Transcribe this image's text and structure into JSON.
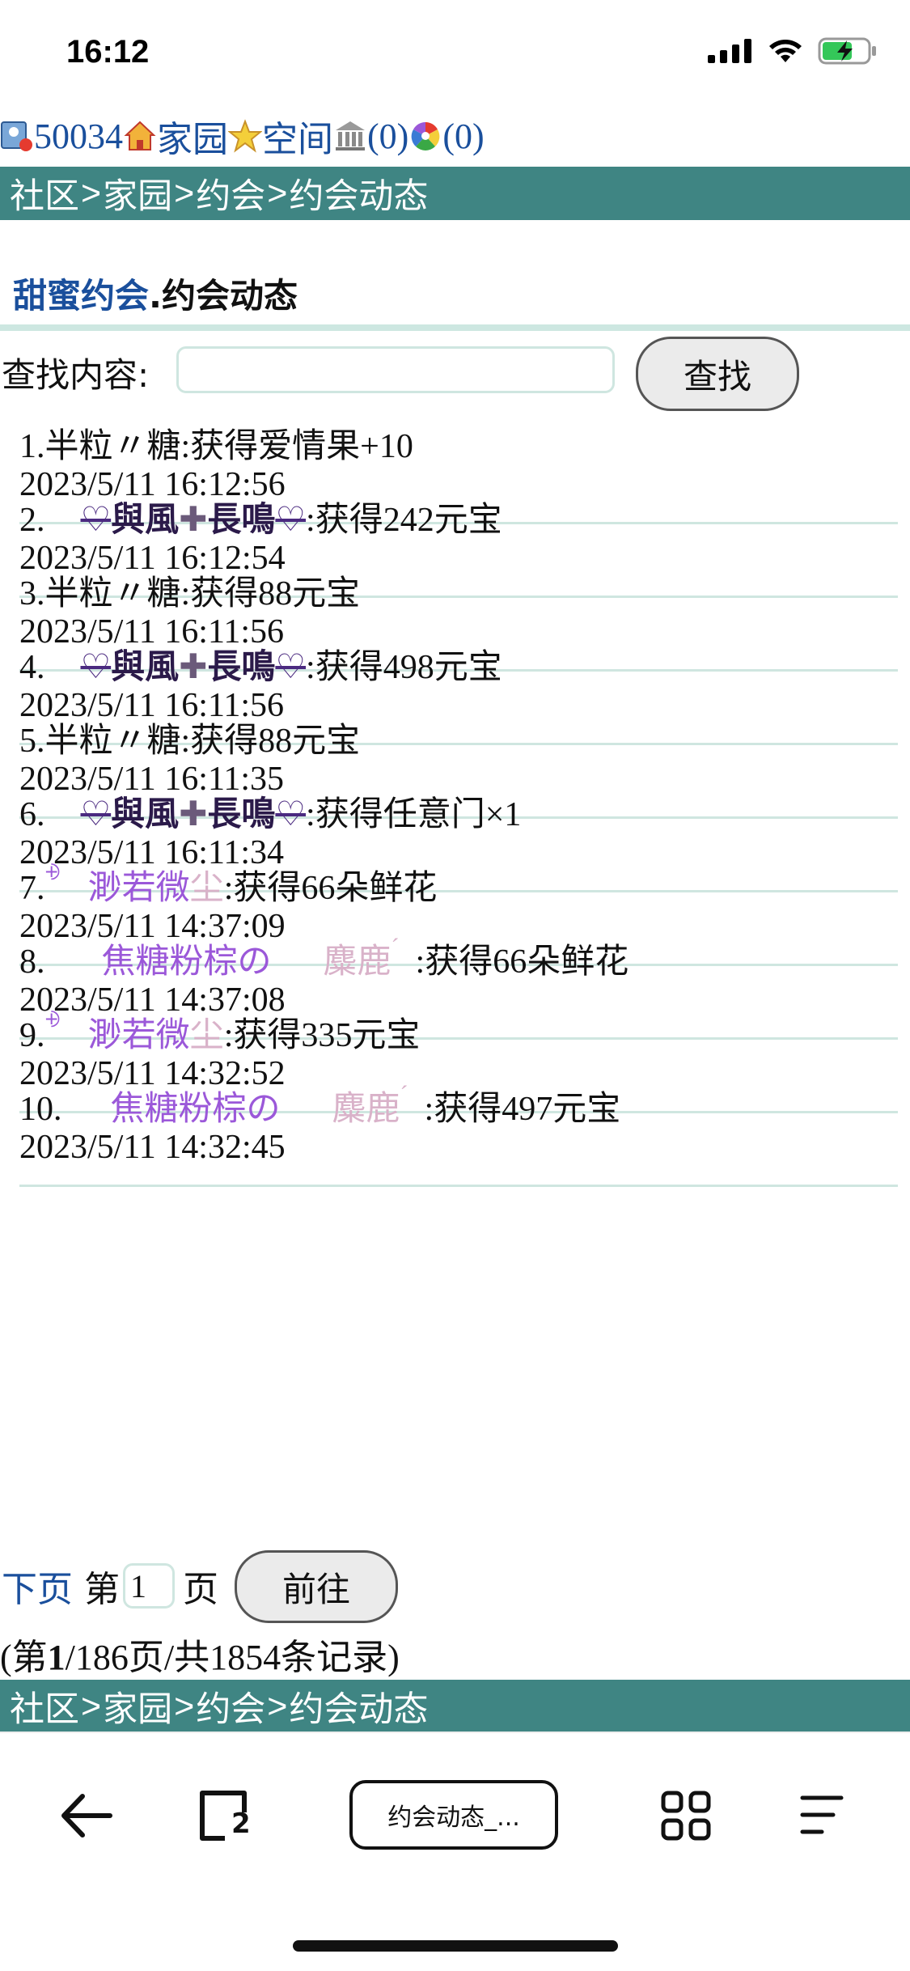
{
  "status": {
    "time": "16:12"
  },
  "topnav": {
    "user_id": "50034",
    "home": "家园",
    "space": "空间",
    "count1": "(0)",
    "count2": "(0)"
  },
  "breadcrumb": {
    "a": "社区",
    "b": "家园",
    "c": "约会",
    "d": "约会动态",
    "sep": ">"
  },
  "title": {
    "site": "甜蜜约会",
    "page": ".约会动态"
  },
  "search": {
    "label": "查找内容:",
    "button": "查找",
    "value": ""
  },
  "records": [
    {
      "no": "1.",
      "user": "半粒〃糖",
      "action": ":获得爱情果+10",
      "time": "2023/5/11 16:12:56",
      "style": "plain"
    },
    {
      "no": "2.",
      "user_parts": [
        "與風",
        "長鳴"
      ],
      "action": ":获得242元宝",
      "time": "2023/5/11 16:12:54",
      "style": "heart"
    },
    {
      "no": "3.",
      "user": "半粒〃糖",
      "action": ":获得88元宝",
      "time": "2023/5/11 16:11:56",
      "style": "plain"
    },
    {
      "no": "4.",
      "user_parts": [
        "與風",
        "長鳴"
      ],
      "action": ":获得498元宝",
      "time": "2023/5/11 16:11:56",
      "style": "heart"
    },
    {
      "no": "5.",
      "user": "半粒〃糖",
      "action": ":获得88元宝",
      "time": "2023/5/11 16:11:35",
      "style": "plain"
    },
    {
      "no": "6.",
      "user_parts": [
        "與風",
        "長鳴"
      ],
      "action": ":获得任意门×1",
      "time": "2023/5/11 16:11:34",
      "style": "heart"
    },
    {
      "no": "7.",
      "user_parts": [
        "渺若微",
        "尘"
      ],
      "action": ":获得66朵鲜花",
      "time": "2023/5/11 14:37:09",
      "style": "purple"
    },
    {
      "no": "8.",
      "user_parts": [
        "焦糖粉棕の",
        "麋鹿"
      ],
      "action": ":获得66朵鲜花",
      "time": "2023/5/11 14:37:08",
      "style": "caramel"
    },
    {
      "no": "9.",
      "user_parts": [
        "渺若微",
        "尘"
      ],
      "action": ":获得335元宝",
      "time": "2023/5/11 14:32:52",
      "style": "purple"
    },
    {
      "no": "10.",
      "user_parts": [
        "焦糖粉棕の",
        "麋鹿"
      ],
      "action": ":获得497元宝",
      "time": "2023/5/11 14:32:45",
      "style": "caramel"
    }
  ],
  "pager": {
    "next": "下页",
    "page_prefix": "第",
    "page_value": "1",
    "page_suffix": "页",
    "go": "前往",
    "info_prefix": "(第",
    "current": "1",
    "info_mid": "/186页/共1854条记录)"
  },
  "toolbar": {
    "tab_title": "约会动态_...",
    "tab_count": "2"
  },
  "colors": {
    "bar": "#3f8583",
    "link": "#1a4f9c",
    "rule": "#cfe6e0"
  }
}
